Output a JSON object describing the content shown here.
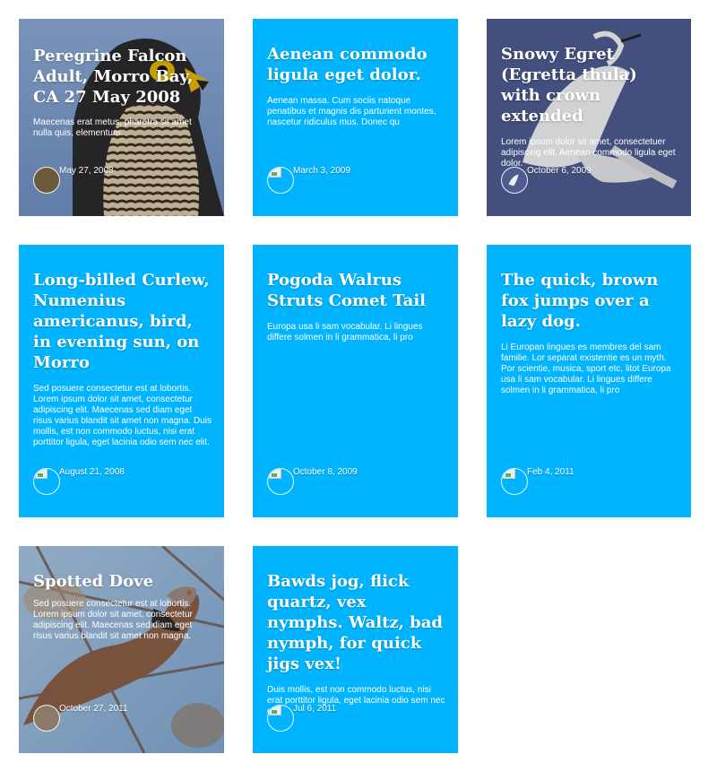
{
  "cards": [
    {
      "title": "Peregrine Falcon Adult, Morro Bay, CA 27 May 2008",
      "excerpt": "Maecenas erat metus, pharetra sit amet nulla quis, elementum.",
      "date": "May 27, 2008",
      "image": "peregrine-falcon-photo"
    },
    {
      "title": "Aenean commodo ligula eget dolor.",
      "excerpt": "Aenean massa. Cum sociis natoque penatibus et magnis dis parturient montes, nascetur ridiculus mus. Donec qu",
      "date": "March 3, 2009"
    },
    {
      "title": "Snowy Egret (Egretta thula) with crown extended",
      "excerpt": "Lorem ipsum dolor sit amet, consectetuer adipiscing elit. Aenean commodo ligula eget dolor.",
      "date": "October 6, 2009",
      "image": "snowy-egret-photo"
    },
    {
      "title": "Long-billed Curlew, Numenius americanus, bird, in evening sun, on Morro",
      "excerpt": "Sed posuere consectetur est at lobortis. Lorem ipsum dolor sit amet, consectetur adipiscing elit. Maecenas sed diam eget risus varius blandit sit amet non magna. Duis mollis, est non commodo luctus, nisi erat porttitor ligula, eget lacinia odio sem nec elit.",
      "date": "August 21, 2008"
    },
    {
      "title": "Pogoda Walrus Struts Comet Tail",
      "excerpt": "Europa usa li sam vocabular. Li lingues differe solmen in li grammatica, li pro",
      "date": "October 8, 2009"
    },
    {
      "title": "The quick, brown fox jumps over a lazy dog.",
      "excerpt": "Li Europan lingues es membres del sam familie. Lor separat existentie es un myth. Por scientie, musica, sport etc, litot Europa usa li sam vocabular. Li lingues differe solmen in li grammatica, li pro",
      "date": "Feb 4, 2011"
    },
    {
      "title": "Spotted Dove",
      "excerpt": "Sed posuere consectetur est at lobortis. Lorem ipsum dolor sit amet, consectetur adipiscing elit. Maecenas sed diam eget risus varius blandit sit amet non magna.",
      "date": "October 27, 2011",
      "image": "spotted-dove-photo"
    },
    {
      "title": "Bawds jog, flick quartz, vex nymphs. Waltz, bad nymph, for quick jigs vex!",
      "excerpt": "Duis mollis, est non commodo luctus, nisi erat porttitor ligula, eget lacinia odio sem nec elit.",
      "date": "Jul 6, 2011"
    }
  ],
  "colors": {
    "card_blue": "#00b4ff",
    "egret_sky": "#4c5a8c",
    "falcon_sky": "#7f9cc8",
    "text": "#ffffff"
  }
}
